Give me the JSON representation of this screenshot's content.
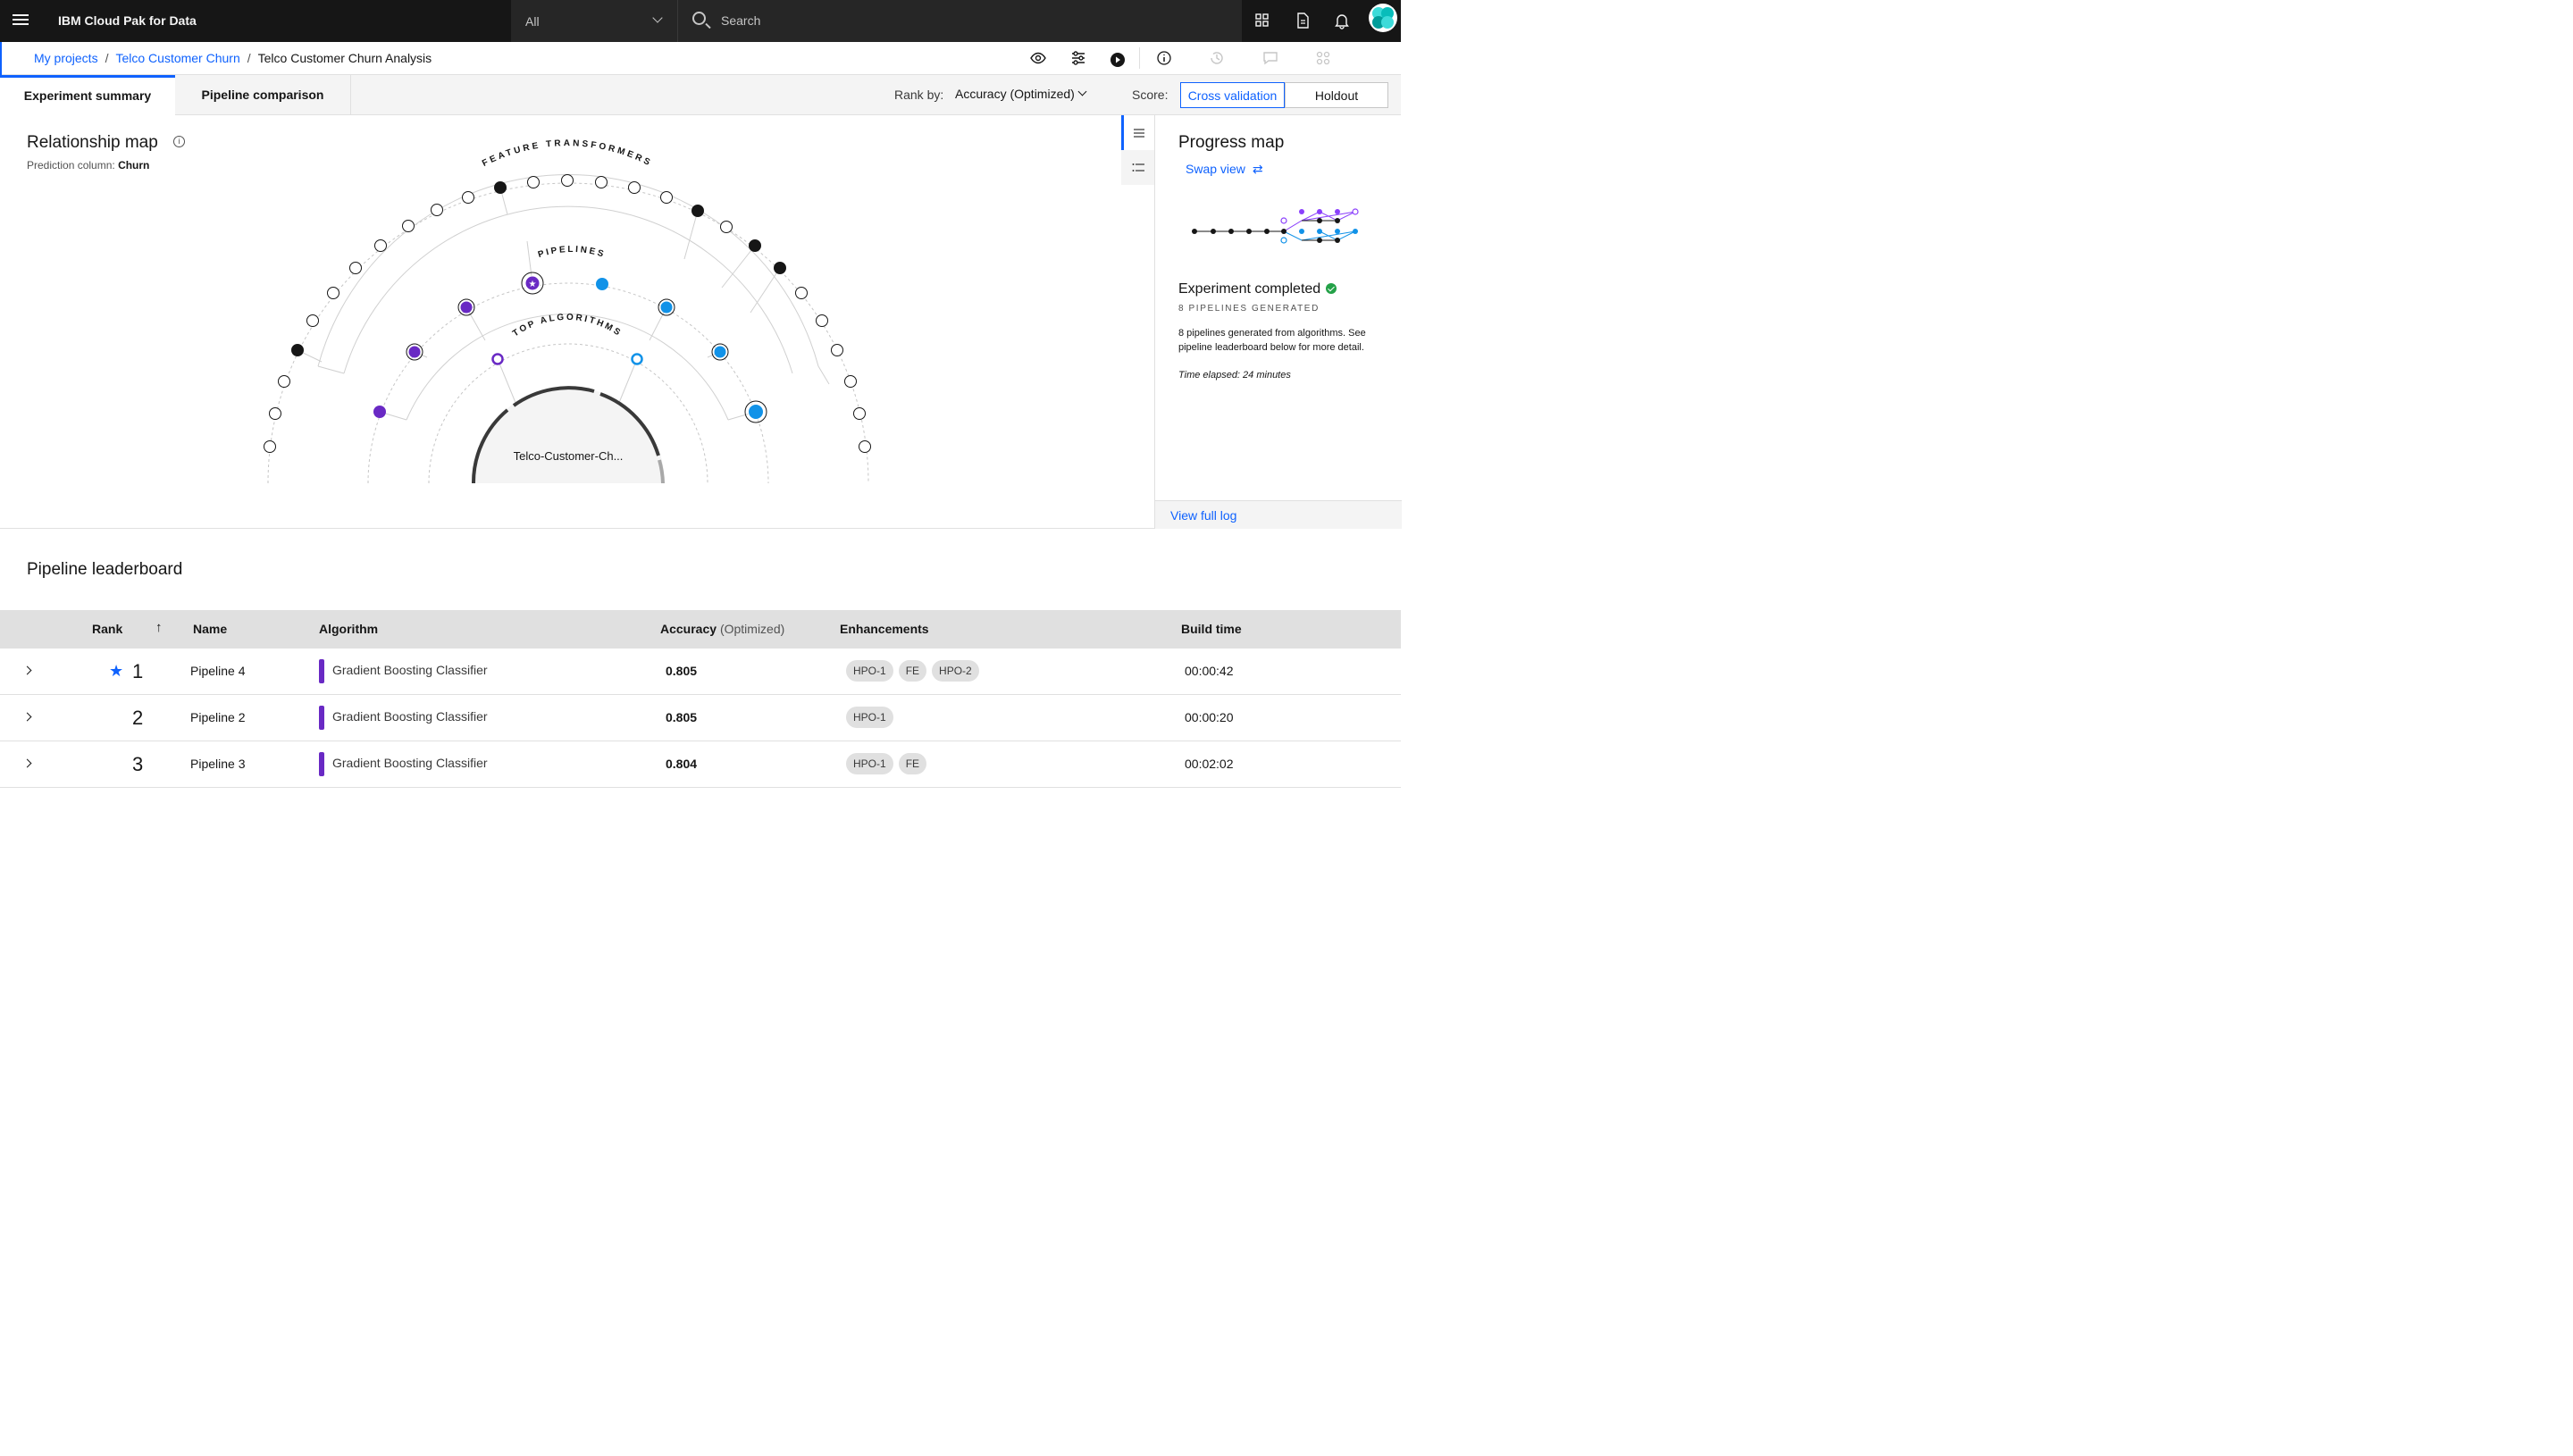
{
  "header": {
    "brand": "IBM Cloud Pak for Data",
    "scope": "All",
    "search_placeholder": "Search"
  },
  "breadcrumb": {
    "items": [
      "My projects",
      "Telco Customer Churn"
    ],
    "current": "Telco Customer Churn Analysis"
  },
  "tabs": [
    {
      "label": "Experiment summary",
      "active": true
    },
    {
      "label": "Pipeline comparison",
      "active": false
    }
  ],
  "rank_by": {
    "label": "Rank by:",
    "value": "Accuracy (Optimized)"
  },
  "score": {
    "label": "Score:",
    "options": [
      "Cross validation",
      "Holdout"
    ],
    "selected": "Cross validation"
  },
  "relationship_map": {
    "title": "Relationship map",
    "prediction_label": "Prediction column:",
    "prediction_value": "Churn",
    "ring_labels": [
      "FEATURE TRANSFORMERS",
      "PIPELINES",
      "TOP ALGORITHMS"
    ],
    "center_label": "Telco-Customer-Ch..."
  },
  "progress_map": {
    "title": "Progress map",
    "swap_label": "Swap view",
    "status": "Experiment completed",
    "pipelines_generated": "8 PIPELINES GENERATED",
    "description": "8 pipelines generated from algorithms. See pipeline leaderboard below for more detail.",
    "elapsed": "Time elapsed: 24 minutes",
    "log_link": "View full log"
  },
  "leaderboard": {
    "title": "Pipeline leaderboard",
    "columns": {
      "rank": "Rank",
      "name": "Name",
      "algorithm": "Algorithm",
      "accuracy": "Accuracy",
      "accuracy_suffix": "(Optimized)",
      "enhancements": "Enhancements",
      "build_time": "Build time"
    },
    "rows": [
      {
        "rank": "1",
        "starred": true,
        "name": "Pipeline 4",
        "algorithm": "Gradient Boosting Classifier",
        "accuracy": "0.805",
        "enhancements": [
          "HPO-1",
          "FE",
          "HPO-2"
        ],
        "build_time": "00:00:42"
      },
      {
        "rank": "2",
        "starred": false,
        "name": "Pipeline 2",
        "algorithm": "Gradient Boosting Classifier",
        "accuracy": "0.805",
        "enhancements": [
          "HPO-1"
        ],
        "build_time": "00:00:20"
      },
      {
        "rank": "3",
        "starred": false,
        "name": "Pipeline 3",
        "algorithm": "Gradient Boosting Classifier",
        "accuracy": "0.804",
        "enhancements": [
          "HPO-1",
          "FE"
        ],
        "build_time": "00:02:02"
      }
    ]
  },
  "colors": {
    "primary": "#0f62fe",
    "purple": "#6929c4",
    "cyan": "#1192e8",
    "success": "#24a148"
  }
}
